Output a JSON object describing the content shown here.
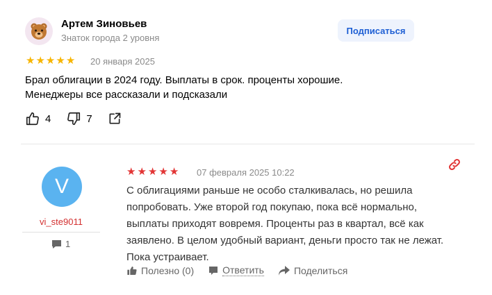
{
  "review1": {
    "author_name": "Артем Зиновьев",
    "author_level": "Знаток города 2 уровня",
    "subscribe_label": "Подписаться",
    "rating": 5,
    "date": "20 января 2025",
    "text_lines": [
      "Брал облигации в 2024 году. Выплаты в срок. проценты хорошие.",
      "Менеджеры все рассказали и подсказали"
    ],
    "likes": "4",
    "dislikes": "7",
    "icons": {
      "avatar": "bear-emoji-icon",
      "like": "thumbs-up-icon",
      "dislike": "thumbs-down-icon",
      "share": "share-icon"
    },
    "colors": {
      "stars": "#f7b500",
      "subscribe_bg": "#eef3fd",
      "subscribe_text": "#1e5fd4"
    }
  },
  "review2": {
    "avatar_letter": "V",
    "username": "vi_ste9011",
    "comments_count": "1",
    "rating": 5,
    "date": "07 февраля 2025 10:22",
    "text": "С облигациями раньше не особо сталкивалась, но решила попробовать. Уже второй год покупаю, пока всё нормально, выплаты приходят вовремя. Проценты раз в квартал, всё как заявлено. В целом удобный вариант, деньги просто так не лежат. Пока устраивает.",
    "useful_label": "Полезно (0)",
    "reply_label": "Ответить",
    "share_label": "Поделиться",
    "icons": {
      "link": "link-icon",
      "comments": "comment-icon",
      "useful": "thumbs-up-icon",
      "reply": "reply-icon",
      "share": "share-arrow-icon"
    },
    "colors": {
      "stars": "#e23535",
      "avatar_bg": "#5ab3f0",
      "username": "#d32f2f",
      "link_icon": "#e23535"
    }
  }
}
